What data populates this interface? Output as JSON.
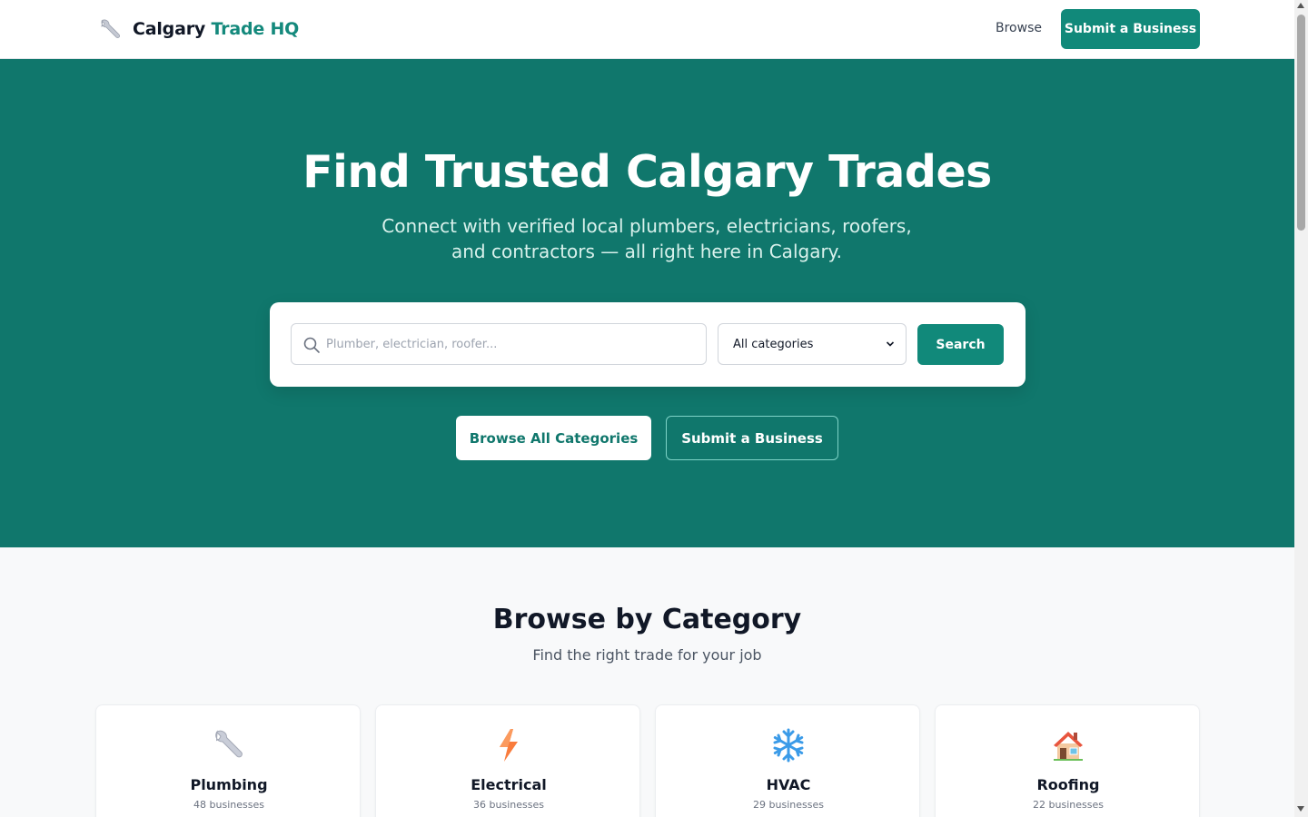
{
  "header": {
    "brand_main": "Calgary",
    "brand_accent": "Trade HQ",
    "brand_icon": "wrench-icon",
    "nav_browse": "Browse",
    "nav_submit": "Submit a Business"
  },
  "hero": {
    "title": "Find Trusted Calgary Trades",
    "subtitle": "Connect with verified local plumbers, electricians, roofers, and contractors — all right here in Calgary.",
    "search": {
      "placeholder": "Plumber, electrician, roofer...",
      "value": "",
      "category_selected": "All categories",
      "button": "Search"
    },
    "browse_button": "Browse All Categories",
    "submit_button": "Submit a Business"
  },
  "categories": {
    "title": "Browse by Category",
    "subtitle": "Find the right trade for your job",
    "items": [
      {
        "name": "Plumbing",
        "count": "48 businesses",
        "icon": "wrench-icon"
      },
      {
        "name": "Electrical",
        "count": "36 businesses",
        "icon": "lightning-icon"
      },
      {
        "name": "HVAC",
        "count": "29 businesses",
        "icon": "snowflake-icon"
      },
      {
        "name": "Roofing",
        "count": "22 businesses",
        "icon": "house-icon"
      }
    ]
  },
  "colors": {
    "primary": "#10776c",
    "button": "#11897a",
    "accent_text": "#14897c"
  }
}
